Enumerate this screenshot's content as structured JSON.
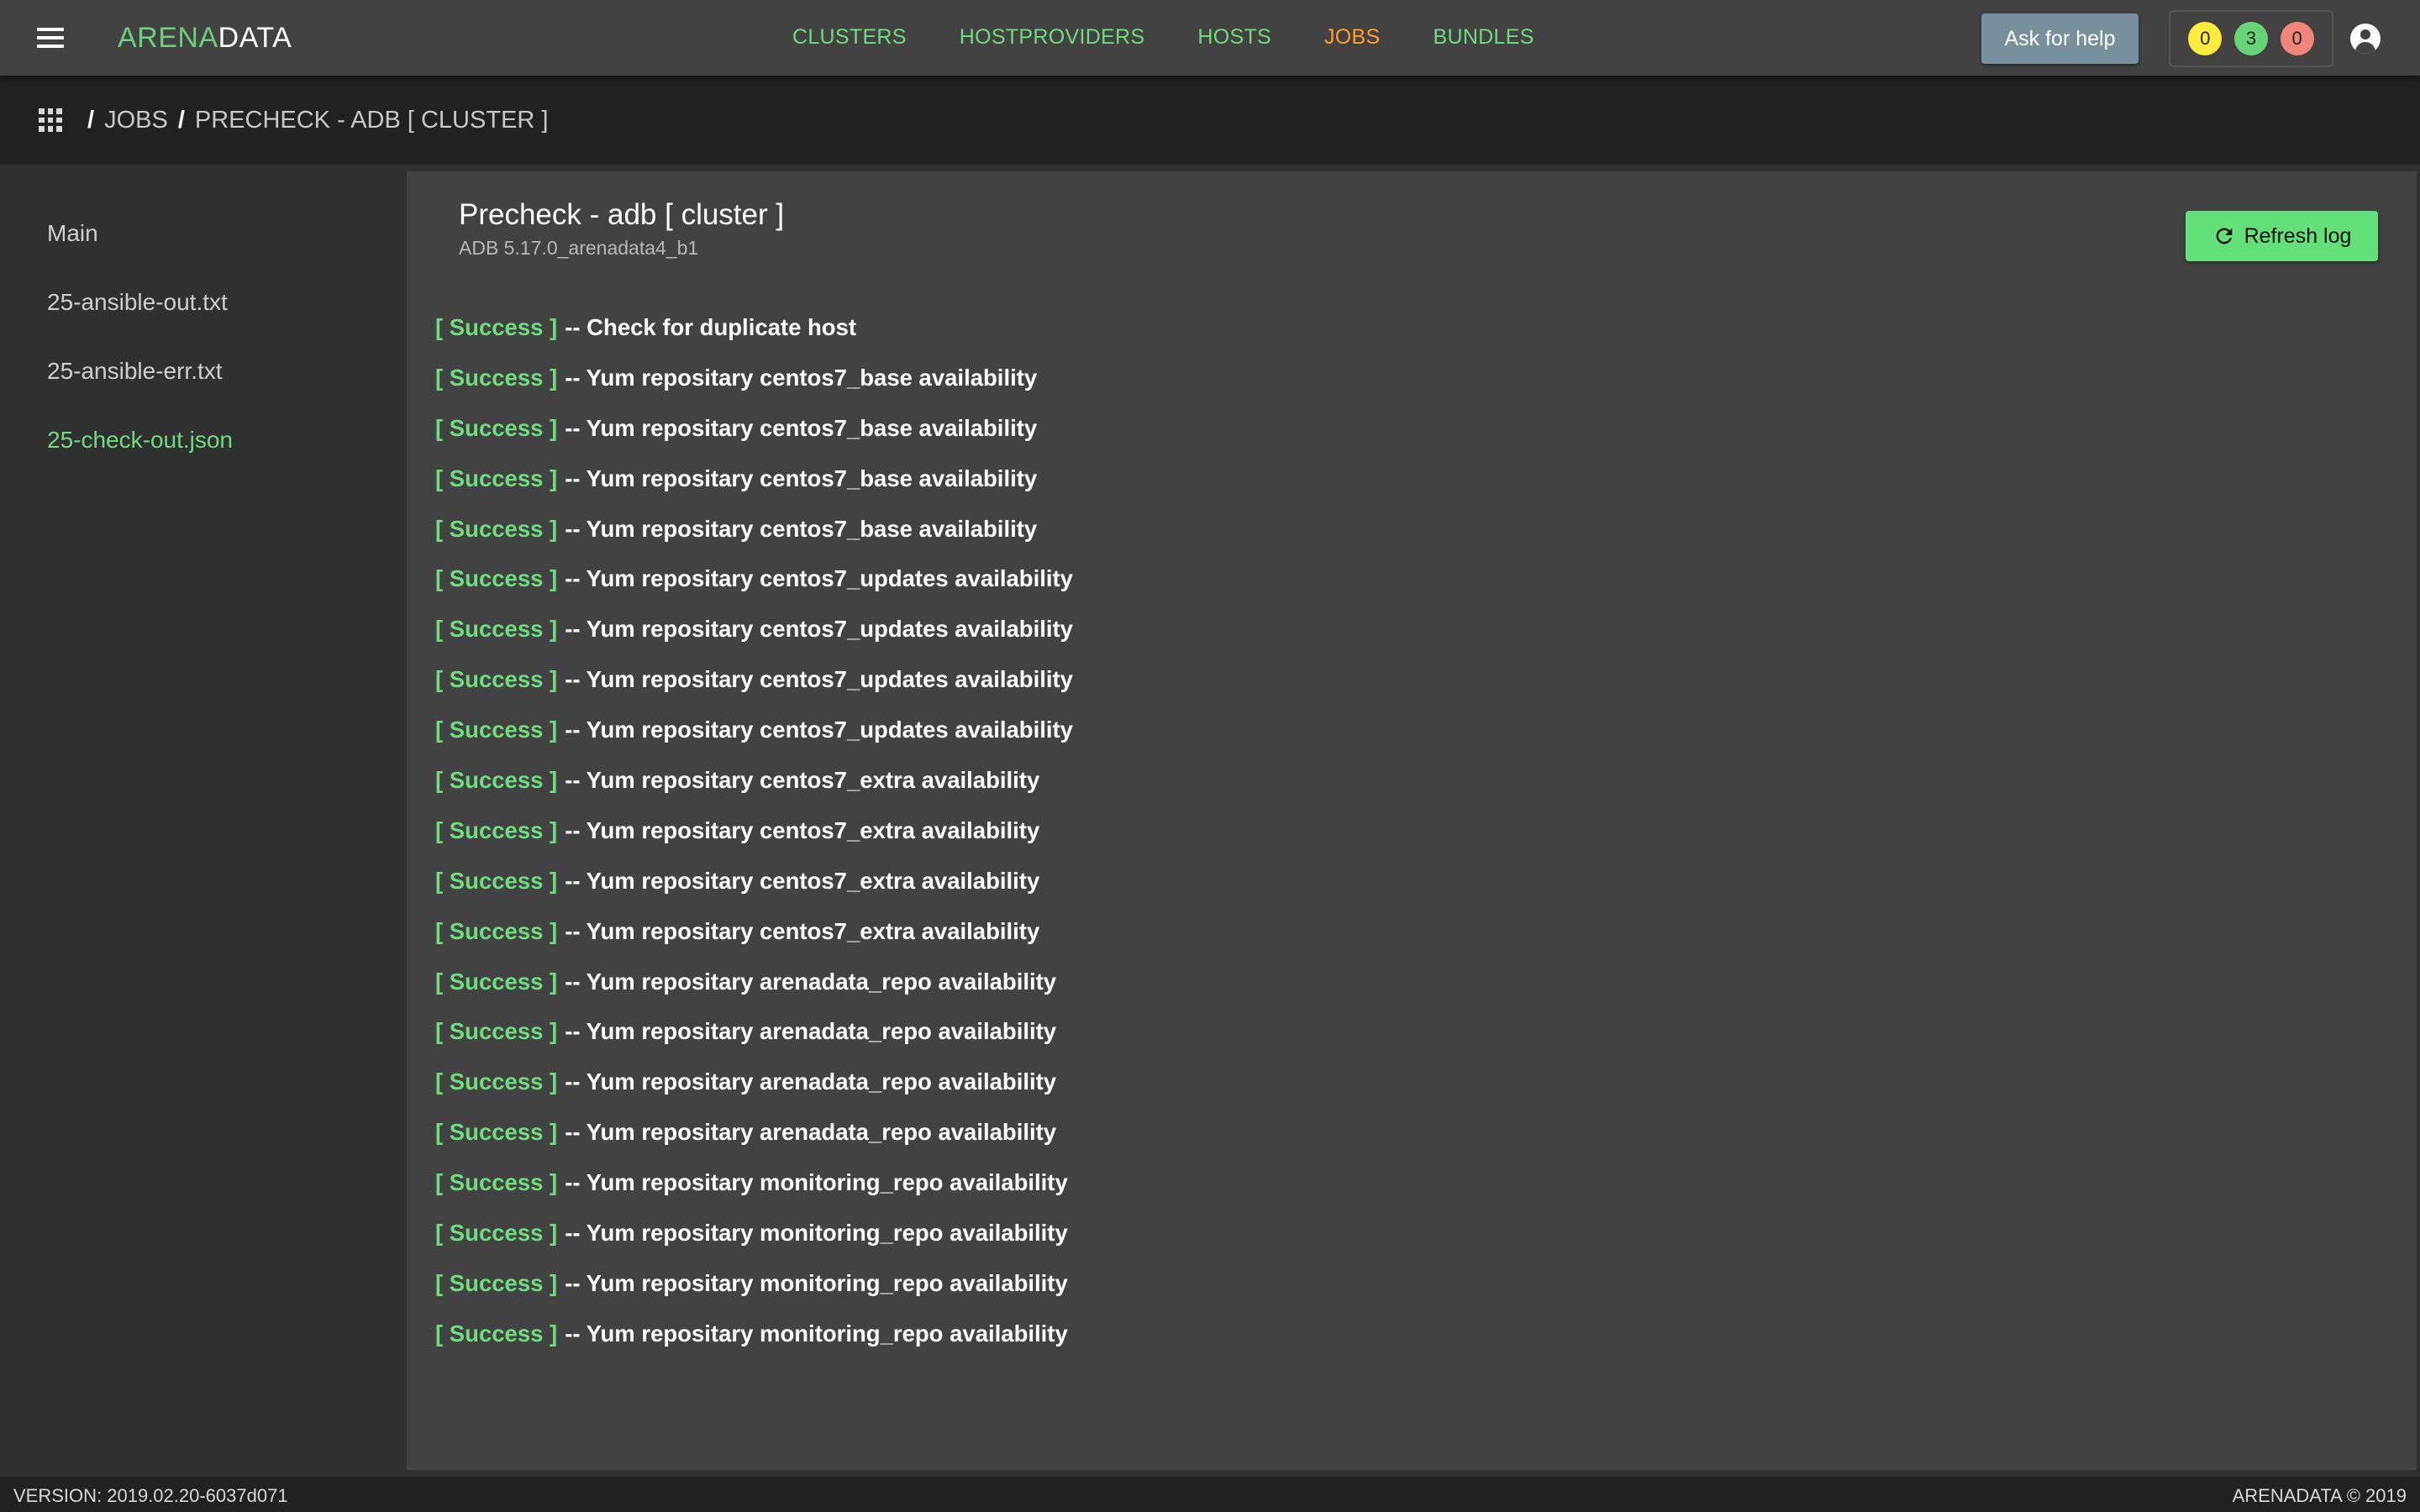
{
  "header": {
    "logo_part1": "ARENA",
    "logo_part2": "DATA",
    "nav": [
      {
        "label": "CLUSTERS",
        "active": false
      },
      {
        "label": "HOSTPROVIDERS",
        "active": false
      },
      {
        "label": "HOSTS",
        "active": false
      },
      {
        "label": "JOBS",
        "active": true
      },
      {
        "label": "BUNDLES",
        "active": false
      }
    ],
    "help_label": "Ask for help",
    "counters": [
      {
        "value": "0",
        "color": "#ffeb3b"
      },
      {
        "value": "3",
        "color": "#66d575"
      },
      {
        "value": "0",
        "color": "#f0857a"
      }
    ]
  },
  "breadcrumbs": {
    "sep": "/",
    "items": [
      "JOBS",
      "PRECHECK - ADB [ CLUSTER ]"
    ]
  },
  "sidebar": {
    "items": [
      {
        "label": "Main",
        "active": false
      },
      {
        "label": "25-ansible-out.txt",
        "active": false
      },
      {
        "label": "25-ansible-err.txt",
        "active": false
      },
      {
        "label": "25-check-out.json",
        "active": true
      }
    ]
  },
  "main": {
    "title": "Precheck - adb [ cluster ]",
    "subtitle": "ADB 5.17.0_arenadata4_b1",
    "refresh_label": "Refresh log",
    "log": [
      {
        "status": "[ Success ]",
        "text": "-- Check for duplicate host"
      },
      {
        "status": "[ Success ]",
        "text": "-- Yum repositary centos7_base availability"
      },
      {
        "status": "[ Success ]",
        "text": "-- Yum repositary centos7_base availability"
      },
      {
        "status": "[ Success ]",
        "text": "-- Yum repositary centos7_base availability"
      },
      {
        "status": "[ Success ]",
        "text": "-- Yum repositary centos7_base availability"
      },
      {
        "status": "[ Success ]",
        "text": "-- Yum repositary centos7_updates availability"
      },
      {
        "status": "[ Success ]",
        "text": "-- Yum repositary centos7_updates availability"
      },
      {
        "status": "[ Success ]",
        "text": "-- Yum repositary centos7_updates availability"
      },
      {
        "status": "[ Success ]",
        "text": "-- Yum repositary centos7_updates availability"
      },
      {
        "status": "[ Success ]",
        "text": "-- Yum repositary centos7_extra availability"
      },
      {
        "status": "[ Success ]",
        "text": "-- Yum repositary centos7_extra availability"
      },
      {
        "status": "[ Success ]",
        "text": "-- Yum repositary centos7_extra availability"
      },
      {
        "status": "[ Success ]",
        "text": "-- Yum repositary centos7_extra availability"
      },
      {
        "status": "[ Success ]",
        "text": "-- Yum repositary arenadata_repo availability"
      },
      {
        "status": "[ Success ]",
        "text": "-- Yum repositary arenadata_repo availability"
      },
      {
        "status": "[ Success ]",
        "text": "-- Yum repositary arenadata_repo availability"
      },
      {
        "status": "[ Success ]",
        "text": "-- Yum repositary arenadata_repo availability"
      },
      {
        "status": "[ Success ]",
        "text": "-- Yum repositary monitoring_repo availability"
      },
      {
        "status": "[ Success ]",
        "text": "-- Yum repositary monitoring_repo availability"
      },
      {
        "status": "[ Success ]",
        "text": "-- Yum repositary monitoring_repo availability"
      },
      {
        "status": "[ Success ]",
        "text": "-- Yum repositary monitoring_repo availability"
      }
    ]
  },
  "footer": {
    "version": "VERSION: 2019.02.20-6037d071",
    "copyright": "ARENADATA © 2019"
  },
  "colors": {
    "accent_green": "#6fdc7d",
    "active_orange": "#ff9e2c",
    "help_button": "#78909c",
    "refresh_button": "#64e07a"
  },
  "icons": {
    "menu": "menu-icon",
    "apps": "apps-grid-icon",
    "refresh": "refresh-icon",
    "account": "account-circle-icon"
  }
}
